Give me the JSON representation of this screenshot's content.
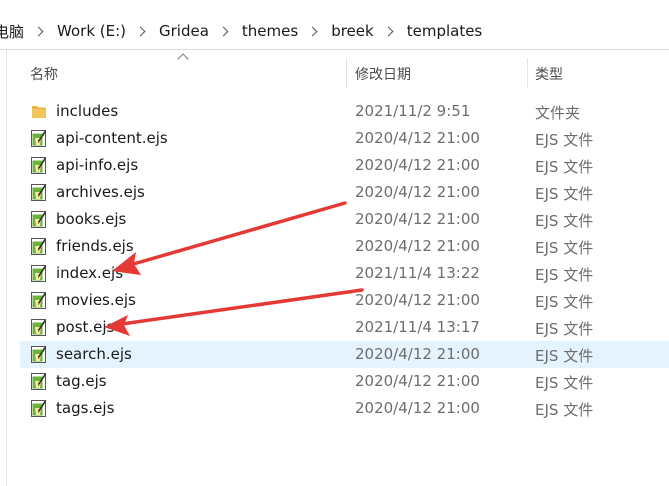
{
  "breadcrumb": {
    "items": [
      "电脑",
      "Work (E:)",
      "Gridea",
      "themes",
      "breek",
      "templates"
    ]
  },
  "columns": {
    "name": "名称",
    "date": "修改日期",
    "type": "类型"
  },
  "files": [
    {
      "name": "includes",
      "date": "2021/11/2 9:51",
      "type": "文件夹",
      "kind": "folder-icon"
    },
    {
      "name": "api-content.ejs",
      "date": "2020/4/12 21:00",
      "type": "EJS 文件",
      "kind": "ejs-file-icon"
    },
    {
      "name": "api-info.ejs",
      "date": "2020/4/12 21:00",
      "type": "EJS 文件",
      "kind": "ejs-file-icon"
    },
    {
      "name": "archives.ejs",
      "date": "2020/4/12 21:00",
      "type": "EJS 文件",
      "kind": "ejs-file-icon"
    },
    {
      "name": "books.ejs",
      "date": "2020/4/12 21:00",
      "type": "EJS 文件",
      "kind": "ejs-file-icon"
    },
    {
      "name": "friends.ejs",
      "date": "2020/4/12 21:00",
      "type": "EJS 文件",
      "kind": "ejs-file-icon"
    },
    {
      "name": "index.ejs",
      "date": "2021/11/4 13:22",
      "type": "EJS 文件",
      "kind": "ejs-file-icon"
    },
    {
      "name": "movies.ejs",
      "date": "2020/4/12 21:00",
      "type": "EJS 文件",
      "kind": "ejs-file-icon"
    },
    {
      "name": "post.ejs",
      "date": "2021/11/4 13:17",
      "type": "EJS 文件",
      "kind": "ejs-file-icon"
    },
    {
      "name": "search.ejs",
      "date": "2020/4/12 21:00",
      "type": "EJS 文件",
      "kind": "ejs-file-icon",
      "selected": true
    },
    {
      "name": "tag.ejs",
      "date": "2020/4/12 21:00",
      "type": "EJS 文件",
      "kind": "ejs-file-icon"
    },
    {
      "name": "tags.ejs",
      "date": "2020/4/12 21:00",
      "type": "EJS 文件",
      "kind": "ejs-file-icon"
    }
  ],
  "colors": {
    "selection": "#e5f3ff",
    "annotation_arrow": "#e53935",
    "folder": "#f2c55c"
  }
}
